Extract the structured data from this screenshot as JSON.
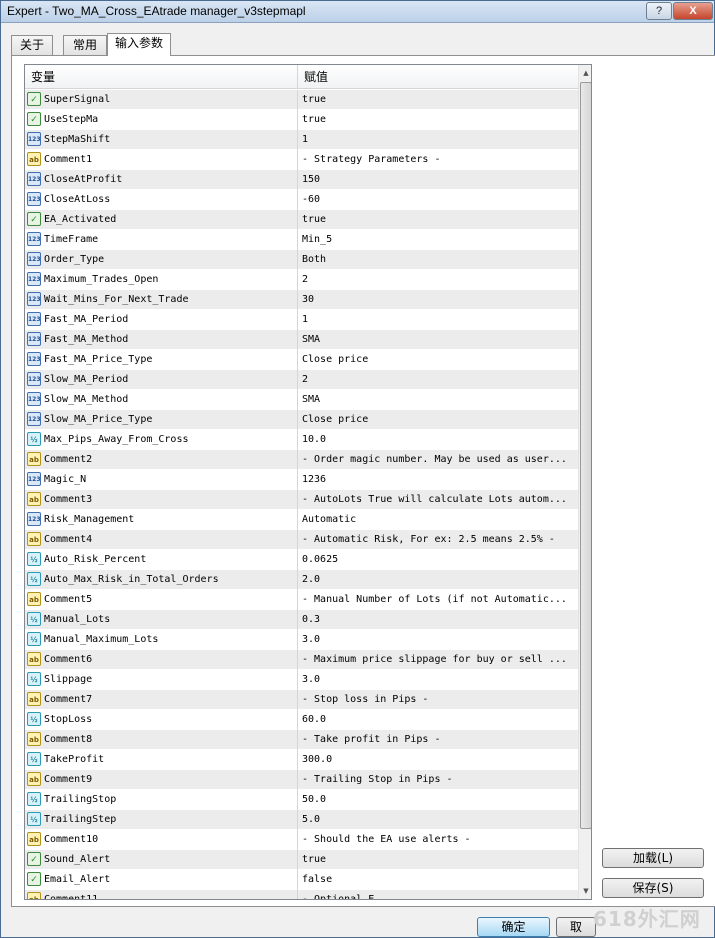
{
  "window": {
    "title": "Expert - Two_MA_Cross_EAtrade manager_v3stepmapl",
    "help_label": "?",
    "close_label": "X"
  },
  "tabs": [
    {
      "label": "关于"
    },
    {
      "label": "常用"
    },
    {
      "label": "输入参数"
    }
  ],
  "grid": {
    "col_variable": "变量",
    "col_value": "赋值",
    "rows": [
      {
        "name": "SuperSignal",
        "value": "true",
        "type": "bool"
      },
      {
        "name": "UseStepMa",
        "value": "true",
        "type": "bool"
      },
      {
        "name": "StepMaShift",
        "value": "1",
        "type": "int"
      },
      {
        "name": "Comment1",
        "value": "- Strategy Parameters -",
        "type": "str"
      },
      {
        "name": "CloseAtProfit",
        "value": "150",
        "type": "int"
      },
      {
        "name": "CloseAtLoss",
        "value": "-60",
        "type": "int"
      },
      {
        "name": "EA_Activated",
        "value": "true",
        "type": "bool"
      },
      {
        "name": "TimeFrame",
        "value": "Min_5",
        "type": "int"
      },
      {
        "name": "Order_Type",
        "value": "Both",
        "type": "int"
      },
      {
        "name": "Maximum_Trades_Open",
        "value": "2",
        "type": "int"
      },
      {
        "name": "Wait_Mins_For_Next_Trade",
        "value": "30",
        "type": "int"
      },
      {
        "name": "Fast_MA_Period",
        "value": "1",
        "type": "int"
      },
      {
        "name": "Fast_MA_Method",
        "value": "SMA",
        "type": "int"
      },
      {
        "name": "Fast_MA_Price_Type",
        "value": "Close price",
        "type": "int"
      },
      {
        "name": "Slow_MA_Period",
        "value": "2",
        "type": "int"
      },
      {
        "name": "Slow_MA_Method",
        "value": "SMA",
        "type": "int"
      },
      {
        "name": "Slow_MA_Price_Type",
        "value": "Close price",
        "type": "int"
      },
      {
        "name": "Max_Pips_Away_From_Cross",
        "value": "10.0",
        "type": "dbl"
      },
      {
        "name": "Comment2",
        "value": "- Order magic number. May be used as user...",
        "type": "str"
      },
      {
        "name": "Magic_N",
        "value": "1236",
        "type": "int"
      },
      {
        "name": "Comment3",
        "value": "- AutoLots True will calculate Lots autom...",
        "type": "str"
      },
      {
        "name": "Risk_Management",
        "value": "Automatic",
        "type": "int"
      },
      {
        "name": "Comment4",
        "value": "- Automatic Risk, For ex: 2.5 means 2.5% -",
        "type": "str"
      },
      {
        "name": "Auto_Risk_Percent",
        "value": "0.0625",
        "type": "dbl"
      },
      {
        "name": "Auto_Max_Risk_in_Total_Orders",
        "value": "2.0",
        "type": "dbl"
      },
      {
        "name": "Comment5",
        "value": "- Manual Number of Lots (if not Automatic...",
        "type": "str"
      },
      {
        "name": "Manual_Lots",
        "value": "0.3",
        "type": "dbl"
      },
      {
        "name": "Manual_Maximum_Lots",
        "value": "3.0",
        "type": "dbl"
      },
      {
        "name": "Comment6",
        "value": "- Maximum price slippage for buy or sell ...",
        "type": "str"
      },
      {
        "name": "Slippage",
        "value": "3.0",
        "type": "dbl"
      },
      {
        "name": "Comment7",
        "value": "- Stop loss in Pips -",
        "type": "str"
      },
      {
        "name": "StopLoss",
        "value": "60.0",
        "type": "dbl"
      },
      {
        "name": "Comment8",
        "value": "- Take profit in Pips -",
        "type": "str"
      },
      {
        "name": "TakeProfit",
        "value": "300.0",
        "type": "dbl"
      },
      {
        "name": "Comment9",
        "value": "- Trailing Stop in Pips -",
        "type": "str"
      },
      {
        "name": "TrailingStop",
        "value": "50.0",
        "type": "dbl"
      },
      {
        "name": "TrailingStep",
        "value": "5.0",
        "type": "dbl"
      },
      {
        "name": "Comment10",
        "value": "- Should the EA use alerts -",
        "type": "str"
      },
      {
        "name": "Sound_Alert",
        "value": "true",
        "type": "bool"
      },
      {
        "name": "Email_Alert",
        "value": "false",
        "type": "bool"
      },
      {
        "name": "Comment11",
        "value": "- Optional E...",
        "type": "str"
      }
    ]
  },
  "icons": {
    "bool": "bool-icon",
    "int": "integer-icon",
    "str": "string-icon",
    "dbl": "double-icon"
  },
  "icon_glyphs": {
    "bool": "✓",
    "int": "123",
    "str": "ab",
    "dbl": "½"
  },
  "buttons": {
    "load": "加载(L)",
    "save": "保存(S)",
    "ok": "确定",
    "cancel": "取"
  },
  "watermark": "618外汇网",
  "colors": {
    "row_alt": "#ececec",
    "titlebar": "#bcd0e8"
  }
}
